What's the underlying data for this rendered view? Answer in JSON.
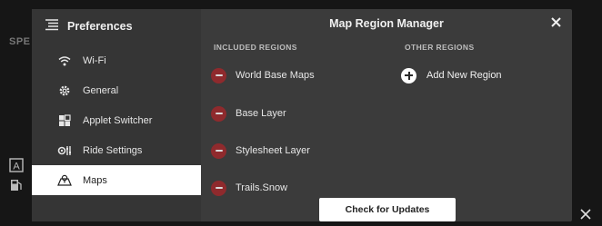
{
  "background": {
    "label": "SPE",
    "close_icon": "close-icon"
  },
  "sidebar": {
    "header_title": "Preferences",
    "header_icon": "list-icon",
    "items": [
      {
        "label": "Wi-Fi",
        "icon": "wifi-icon",
        "active": false
      },
      {
        "label": "General",
        "icon": "gear-icon",
        "active": false
      },
      {
        "label": "Applet Switcher",
        "icon": "grid-icon",
        "active": false
      },
      {
        "label": "Ride Settings",
        "icon": "ride-settings-icon",
        "active": false
      },
      {
        "label": "Maps",
        "icon": "map-icon",
        "active": true
      }
    ]
  },
  "main": {
    "title": "Map Region Manager",
    "included_header": "INCLUDED REGIONS",
    "other_header": "OTHER REGIONS",
    "included_regions": [
      "World Base Maps",
      "Base Layer",
      "Stylesheet Layer",
      "Trails.Snow"
    ],
    "add_region_label": "Add New Region",
    "check_updates_label": "Check for Updates"
  },
  "colors": {
    "modal_bg": "#3b3b3b",
    "sidebar_bg": "#353535",
    "remove_red": "#8f2a2d",
    "active_item_bg": "#ffffff"
  }
}
